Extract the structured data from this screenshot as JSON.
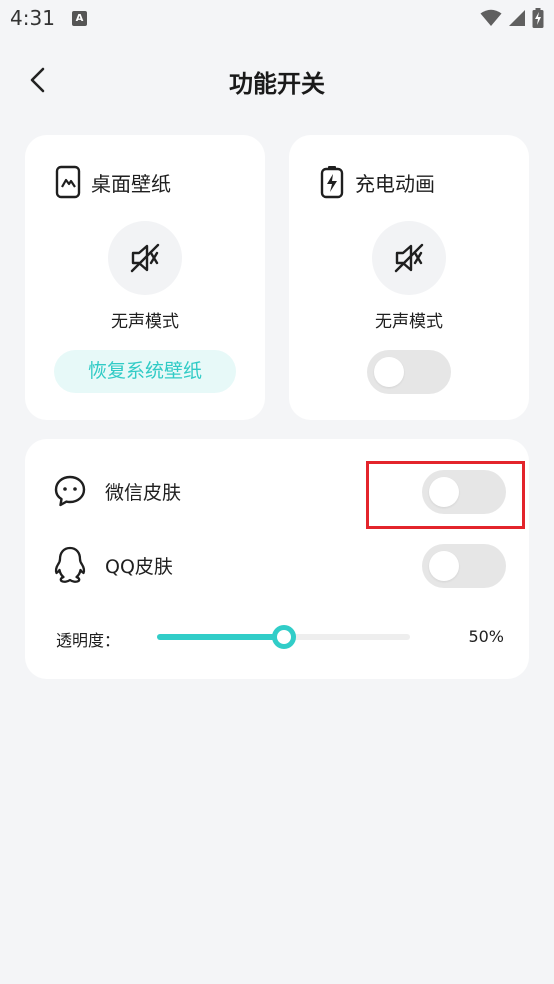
{
  "status_bar": {
    "time": "4:31",
    "notification_glyph": "A",
    "icons": [
      "wifi-icon",
      "signal-icon",
      "battery-charging-icon"
    ]
  },
  "header": {
    "title": "功能开关",
    "back_icon": "chevron-left-icon"
  },
  "wallpaper_card": {
    "title": "桌面壁纸",
    "icon": "wallpaper-icon",
    "mute_icon": "mute-icon",
    "mode_label": "无声模式",
    "restore_button": "恢复系统壁纸"
  },
  "charge_card": {
    "title": "充电动画",
    "icon": "battery-charging-icon",
    "mute_icon": "mute-icon",
    "mode_label": "无声模式",
    "toggle_on": false
  },
  "skins": {
    "wechat": {
      "label": "微信皮肤",
      "icon": "wechat-icon",
      "toggle_on": false
    },
    "qq": {
      "label": "QQ皮肤",
      "icon": "qq-icon",
      "toggle_on": false
    },
    "opacity": {
      "label": "透明度：",
      "value": 50,
      "value_text": "50%"
    }
  },
  "colors": {
    "accent": "#31cdc8",
    "accent_light_bg": "#e7f9f8",
    "highlight": "#e3242b",
    "background": "#f4f5f7"
  }
}
